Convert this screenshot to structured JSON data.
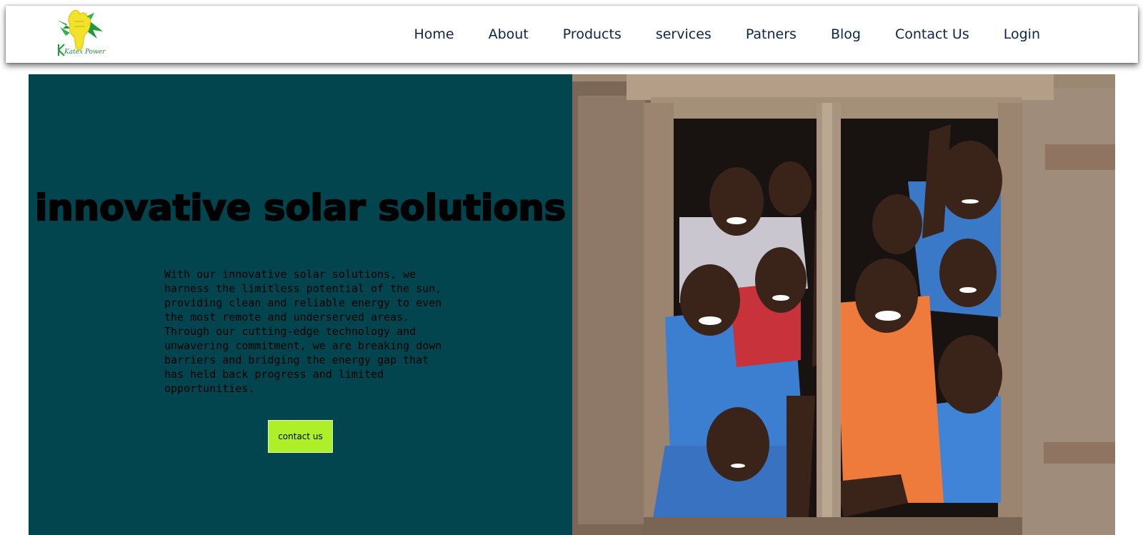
{
  "brand": {
    "logo_text": "Katex Power",
    "colors": {
      "leaf": "#1f9a3e",
      "sun": "#f2e22a"
    }
  },
  "nav": {
    "items": [
      {
        "label": "Home"
      },
      {
        "label": "About"
      },
      {
        "label": "Products"
      },
      {
        "label": "services"
      },
      {
        "label": "Patners"
      },
      {
        "label": "Blog"
      },
      {
        "label": "Contact Us"
      },
      {
        "label": "Login"
      }
    ]
  },
  "hero": {
    "title": "innovative solar solutions",
    "description": "With our innovative solar solutions, we harness the limitless potential of the sun, providing clean and reliable energy to even the most remote and underserved areas. Through our cutting-edge technology and unwavering commitment, we are breaking down barriers and bridging the energy gap that has held back progress and limited opportunities.",
    "button_label": "contact us",
    "image_subject": "children-smiling-at-window"
  },
  "colors": {
    "hero_bg": "#02454f",
    "button_bg": "#adf02a",
    "nav_text": "#0e2444"
  }
}
